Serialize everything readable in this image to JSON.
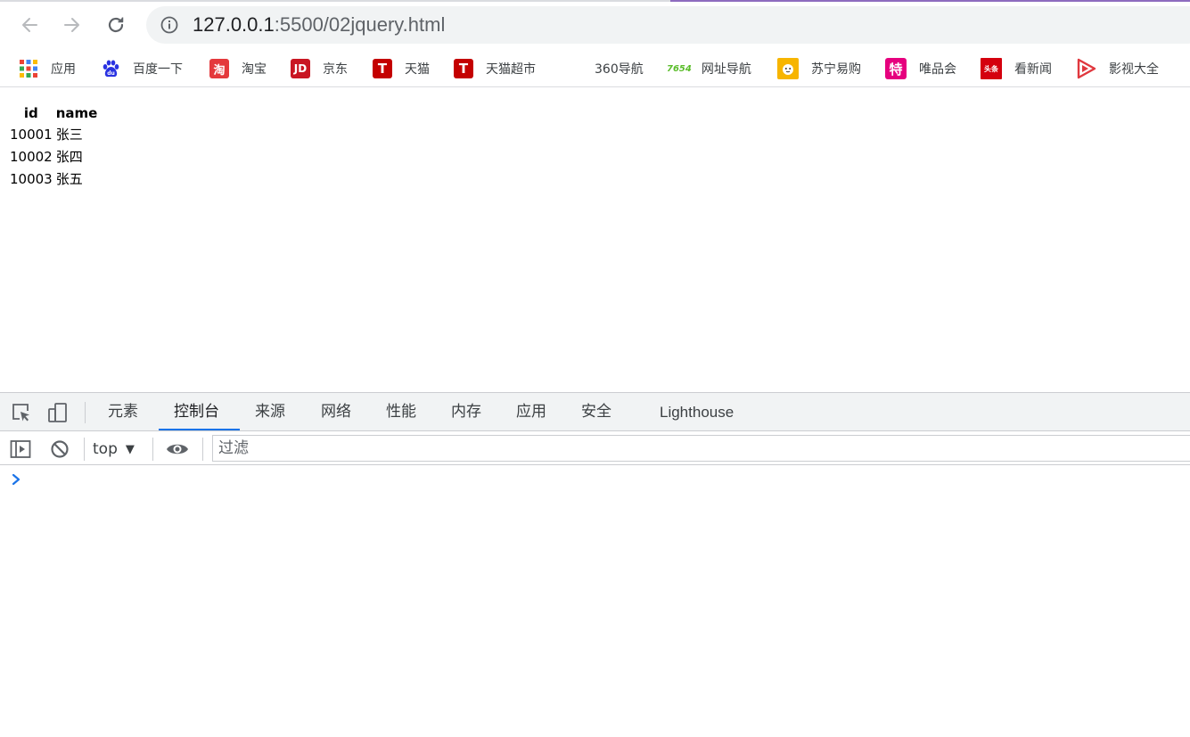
{
  "browser": {
    "url_host": "127.0.0.1",
    "url_rest": ":5500/02jquery.html",
    "accent_color": "#1a73e8"
  },
  "bookmarks": [
    {
      "label": "应用",
      "icon": "apps-grid-icon"
    },
    {
      "label": "百度一下",
      "icon": "baidu-paw-icon",
      "color": "#2932e1"
    },
    {
      "label": "淘宝",
      "icon": "taobao-icon",
      "color": "#e4393c",
      "glyph": "淘"
    },
    {
      "label": "京东",
      "icon": "jd-icon",
      "color": "#c91623",
      "glyph": "JD"
    },
    {
      "label": "天猫",
      "icon": "tmall-icon",
      "color": "#c40000",
      "glyph": "T"
    },
    {
      "label": "天猫超市",
      "icon": "tmall-supermarket-icon",
      "color": "#c40000",
      "glyph": "T"
    },
    {
      "label": "360导航",
      "icon": "none"
    },
    {
      "label": "网址导航",
      "icon": "7654-icon",
      "color": "#5bbd2b",
      "glyph": "7654"
    },
    {
      "label": "苏宁易购",
      "icon": "suning-icon",
      "color": "#f7b500"
    },
    {
      "label": "唯品会",
      "icon": "vip-icon",
      "color": "#e6007e",
      "glyph": "特"
    },
    {
      "label": "看新闻",
      "icon": "news-icon",
      "color": "#d4000e",
      "glyph": "头条"
    },
    {
      "label": "影视大全",
      "icon": "video-play-icon",
      "color": "#e0383e"
    }
  ],
  "table": {
    "headers": [
      "id",
      "name"
    ],
    "rows": [
      [
        "10001",
        "张三"
      ],
      [
        "10002",
        "张四"
      ],
      [
        "10003",
        "张五"
      ]
    ]
  },
  "devtools": {
    "tabs": [
      "元素",
      "控制台",
      "来源",
      "网络",
      "性能",
      "内存",
      "应用",
      "安全",
      "Lighthouse"
    ],
    "active_tab": "控制台",
    "context": "top",
    "filter_placeholder": "过滤"
  }
}
